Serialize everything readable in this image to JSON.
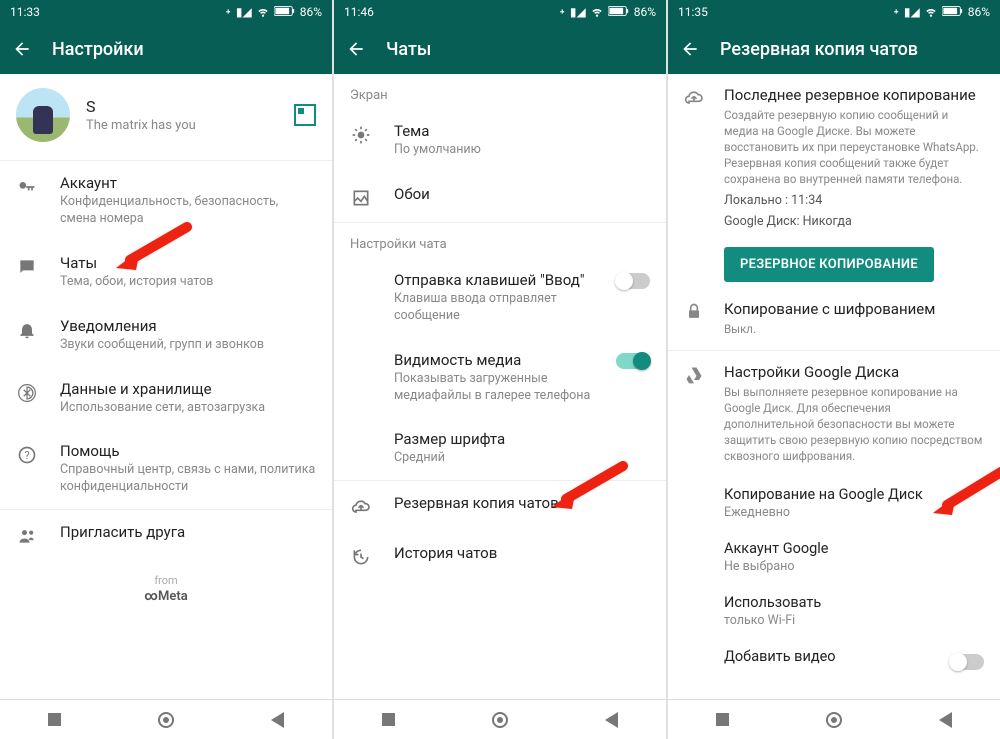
{
  "status": {
    "battery": "86%"
  },
  "panel1": {
    "time": "11:33",
    "appbar_title": "Настройки",
    "profile_name": "S",
    "profile_status": "The matrix has you",
    "items": {
      "account": {
        "title": "Аккаунт",
        "subtitle": "Конфиденциальность, безопасность, смена номера"
      },
      "chats": {
        "title": "Чаты",
        "subtitle": "Тема, обои, история чатов"
      },
      "notif": {
        "title": "Уведомления",
        "subtitle": "Звуки сообщений, групп и звонков"
      },
      "data": {
        "title": "Данные и хранилище",
        "subtitle": "Использование сети, автозагрузка"
      },
      "help": {
        "title": "Помощь",
        "subtitle": "Справочный центр, связь с нами, политика конфиденциальности"
      },
      "invite": {
        "title": "Пригласить друга"
      }
    },
    "from": "from",
    "meta": "Meta"
  },
  "panel2": {
    "time": "11:46",
    "appbar_title": "Чаты",
    "section_screen": "Экран",
    "theme": {
      "title": "Тема",
      "subtitle": "По умолчанию"
    },
    "wallpaper": {
      "title": "Обои"
    },
    "section_chat": "Настройки чата",
    "enter": {
      "title": "Отправка клавишей \"Ввод\"",
      "subtitle": "Клавиша ввода отправляет сообщение"
    },
    "media": {
      "title": "Видимость медиа",
      "subtitle": "Показывать загруженные медиафайлы в галерее телефона"
    },
    "font": {
      "title": "Размер шрифта",
      "subtitle": "Средний"
    },
    "backup": {
      "title": "Резервная копия чатов"
    },
    "history": {
      "title": "История чатов"
    }
  },
  "panel3": {
    "time": "11:35",
    "appbar_title": "Резервная копия чатов",
    "last": {
      "title": "Последнее резервное копирование",
      "desc": "Создайте резервную копию сообщений и медиа на Google Диске. Вы можете восстановить их при переустановке WhatsApp. Резервная копия сообщений также будет сохранена во внутренней памяти телефона.",
      "local": "Локально : 11:34",
      "gdrive": "Google Диск: Никогда"
    },
    "backup_btn": "РЕЗЕРВНОЕ КОПИРОВАНИЕ",
    "encrypt": {
      "title": "Копирование с шифрованием",
      "subtitle": "Выкл."
    },
    "gdrive_section": {
      "title": "Настройки Google Диска",
      "desc": "Вы выполняете резервное копирование на Google Диск. Для обеспечения дополнительной безопасности вы можете защитить свою резервную копию посредством сквозного шифрования."
    },
    "to_drive": {
      "title": "Копирование на Google Диск",
      "subtitle": "Ежедневно"
    },
    "account": {
      "title": "Аккаунт Google",
      "subtitle": "Не выбрано"
    },
    "use": {
      "title": "Использовать",
      "subtitle": "только Wi-Fi"
    },
    "video": {
      "title": "Добавить видео"
    }
  }
}
